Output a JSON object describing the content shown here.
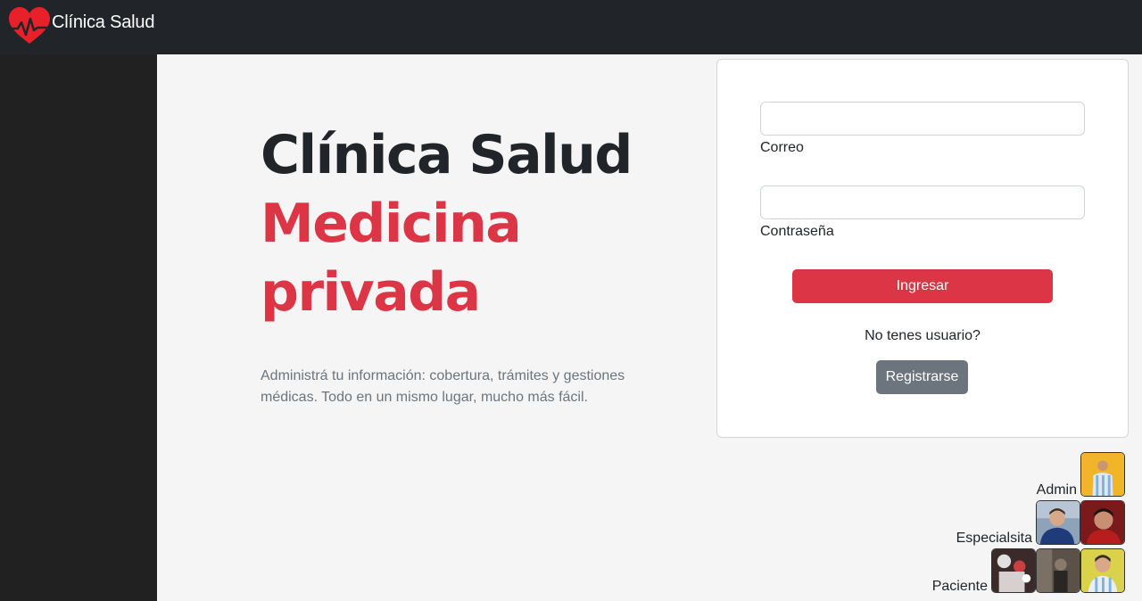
{
  "navbar": {
    "brand_text": "Clínica Salud",
    "logo_color": "#e8202a"
  },
  "hero": {
    "title": "Clínica Salud",
    "subtitle_line1": "Medicina",
    "subtitle_line2": "privada",
    "description": "Administrá tu información: cobertura, trámites y gestiones médicas. Todo en un mismo lugar, mucho más fácil."
  },
  "login": {
    "email_label": "Correo",
    "email_value": "",
    "password_label": "Contraseña",
    "password_value": "",
    "submit_label": "Ingresar",
    "no_user_text": "No tenes usuario?",
    "register_label": "Registrarse"
  },
  "quick_access": [
    {
      "label": "Admin",
      "avatars": 1
    },
    {
      "label": "Especialsita",
      "avatars": 2
    },
    {
      "label": "Paciente",
      "avatars": 3
    }
  ],
  "colors": {
    "accent": "#dc3545",
    "navbar": "#212529",
    "sidebar": "#212121",
    "secondary": "#6c757d"
  }
}
